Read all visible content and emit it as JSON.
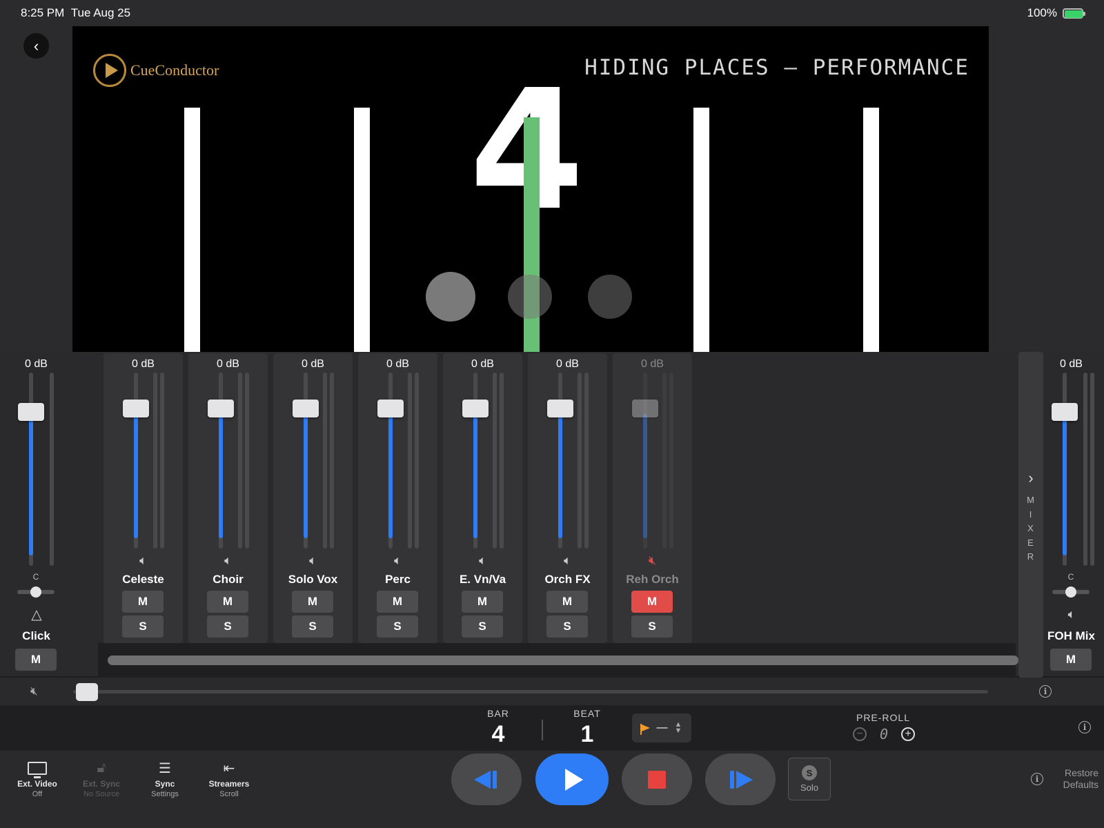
{
  "status_bar": {
    "time": "8:25 PM",
    "date": "Tue Aug 25",
    "battery": "100%"
  },
  "video": {
    "logo_text": "CueConductor",
    "title": "HIDING PLACES – PERFORMANCE",
    "big_number": "4"
  },
  "master_left": {
    "db": "0 dB",
    "pan": "C",
    "name": "Click",
    "mute_label": "M",
    "icon": "metronome-icon"
  },
  "channels": [
    {
      "db": "0 dB",
      "name": "Celeste",
      "m": "M",
      "s": "S",
      "muted": false
    },
    {
      "db": "0 dB",
      "name": "Choir",
      "m": "M",
      "s": "S",
      "muted": false
    },
    {
      "db": "0 dB",
      "name": "Solo Vox",
      "m": "M",
      "s": "S",
      "muted": false
    },
    {
      "db": "0 dB",
      "name": "Perc",
      "m": "M",
      "s": "S",
      "muted": false
    },
    {
      "db": "0 dB",
      "name": "E. Vn/Va",
      "m": "M",
      "s": "S",
      "muted": false
    },
    {
      "db": "0 dB",
      "name": "Orch FX",
      "m": "M",
      "s": "S",
      "muted": false
    },
    {
      "db": "0 dB",
      "name": "Reh Orch",
      "m": "M",
      "s": "S",
      "muted": true
    }
  ],
  "mixer_tab": {
    "chevron": "›",
    "letters": "M\nI\nX\nE\nR"
  },
  "master_right": {
    "db": "0 dB",
    "pan": "C",
    "name": "FOH Mix",
    "mute_label": "M"
  },
  "position": {
    "bar_label": "BAR",
    "bar_value": "4",
    "beat_label": "BEAT",
    "beat_value": "1",
    "marker_value": "—"
  },
  "preroll": {
    "label": "PRE-ROLL",
    "value": "0",
    "minus": "−",
    "plus": "+"
  },
  "toolbar": {
    "ext_video": {
      "label": "Ext. Video",
      "sub": "Off"
    },
    "ext_sync": {
      "label": "Ext. Sync",
      "sub": "No Source"
    },
    "sync": {
      "label": "Sync",
      "sub": "Settings"
    },
    "streamers": {
      "label": "Streamers",
      "sub": "Scroll"
    },
    "solo": {
      "letter": "S",
      "label": "Solo"
    },
    "restore": "Restore Defaults"
  },
  "colors": {
    "accent": "#2e7cf6",
    "stop": "#e8423f",
    "mute_active": "#e14b48",
    "streamer_green": "#68c074",
    "marker_flag": "#f19a2c"
  }
}
